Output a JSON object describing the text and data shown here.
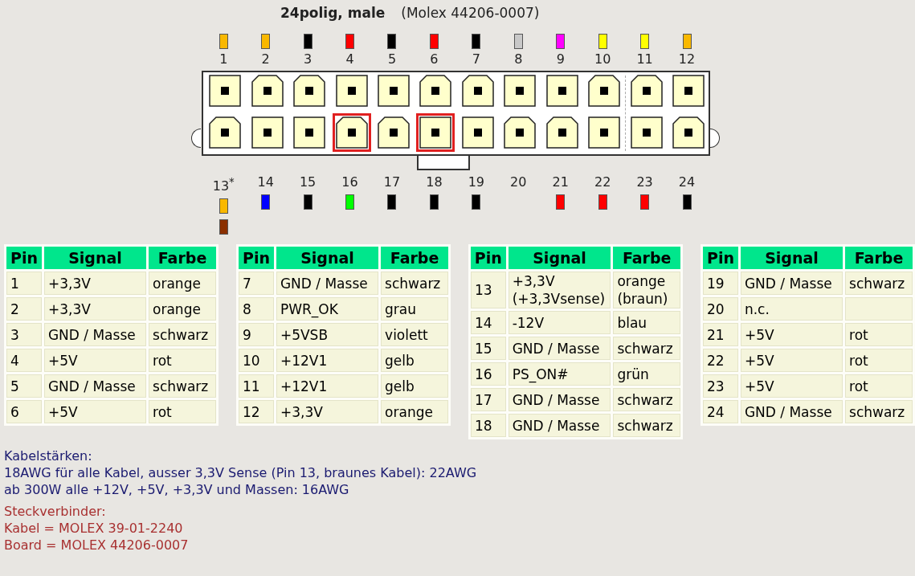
{
  "title": {
    "name": "24polig, male",
    "part": "(Molex 44206-0007)"
  },
  "connector": {
    "top_pins": [
      {
        "label": "1",
        "kind": "square",
        "highlighted": false,
        "wires": [
          {
            "color": "#f9b800"
          }
        ]
      },
      {
        "label": "2",
        "kind": "chamfered",
        "highlighted": false,
        "wires": [
          {
            "color": "#f9b800"
          }
        ]
      },
      {
        "label": "3",
        "kind": "chamfered",
        "highlighted": false,
        "wires": [
          {
            "color": "#000000"
          }
        ]
      },
      {
        "label": "4",
        "kind": "square",
        "highlighted": false,
        "wires": [
          {
            "color": "#ff0000"
          }
        ]
      },
      {
        "label": "5",
        "kind": "square",
        "highlighted": false,
        "wires": [
          {
            "color": "#000000"
          }
        ]
      },
      {
        "label": "6",
        "kind": "chamfered",
        "highlighted": false,
        "wires": [
          {
            "color": "#ff0000"
          }
        ]
      },
      {
        "label": "7",
        "kind": "chamfered",
        "highlighted": false,
        "wires": [
          {
            "color": "#000000"
          }
        ]
      },
      {
        "label": "8",
        "kind": "square",
        "highlighted": false,
        "wires": [
          {
            "color": "#c8c8c8"
          }
        ]
      },
      {
        "label": "9",
        "kind": "square",
        "highlighted": false,
        "wires": [
          {
            "color": "#ff00ff"
          }
        ]
      },
      {
        "label": "10",
        "kind": "chamfered",
        "highlighted": false,
        "wires": [
          {
            "color": "#ffff00"
          }
        ]
      },
      {
        "label": "11",
        "kind": "chamfered",
        "highlighted": false,
        "wires": [
          {
            "color": "#ffff00"
          }
        ]
      },
      {
        "label": "12",
        "kind": "square",
        "highlighted": false,
        "wires": [
          {
            "color": "#f9b800"
          }
        ]
      }
    ],
    "bottom_pins": [
      {
        "label": "13$^{*}$",
        "kind": "chamfered",
        "highlighted": false,
        "wires": [
          {
            "color": "#f9b800"
          },
          {
            "color": "#8b3000"
          }
        ]
      },
      {
        "label": "14",
        "kind": "square",
        "highlighted": false,
        "wires": [
          {
            "color": "#0000ff"
          }
        ]
      },
      {
        "label": "15",
        "kind": "square",
        "highlighted": false,
        "wires": [
          {
            "color": "#000000"
          }
        ]
      },
      {
        "label": "16",
        "kind": "chamfered",
        "highlighted": true,
        "wires": [
          {
            "color": "#00ff00"
          }
        ]
      },
      {
        "label": "17",
        "kind": "chamfered",
        "highlighted": false,
        "wires": [
          {
            "color": "#000000"
          }
        ]
      },
      {
        "label": "18",
        "kind": "square",
        "highlighted": true,
        "wires": [
          {
            "color": "#000000"
          }
        ]
      },
      {
        "label": "19",
        "kind": "square",
        "highlighted": false,
        "wires": [
          {
            "color": "#000000"
          }
        ]
      },
      {
        "label": "20",
        "kind": "chamfered",
        "highlighted": false
      },
      {
        "label": "21",
        "kind": "chamfered",
        "highlighted": false,
        "wires": [
          {
            "color": "#ff0000"
          }
        ]
      },
      {
        "label": "22",
        "kind": "square",
        "highlighted": false,
        "wires": [
          {
            "color": "#ff0000"
          }
        ]
      },
      {
        "label": "23",
        "kind": "square",
        "highlighted": false,
        "wires": [
          {
            "color": "#ff0000"
          }
        ]
      },
      {
        "label": "24",
        "kind": "chamfered",
        "highlighted": false,
        "wires": [
          {
            "color": "#000000"
          }
        ]
      }
    ]
  },
  "tables": [
    {
      "columns": [
        "Pin",
        "Signal",
        "Farbe"
      ],
      "rows": [
        {
          "pin": "1",
          "signal": "+3,3V",
          "wire": "orange"
        },
        {
          "pin": "2",
          "signal": "+3,3V",
          "wire": "orange"
        },
        {
          "pin": "3",
          "signal": "GND / Masse",
          "wire": "schwarz"
        },
        {
          "pin": "4",
          "signal": "+5V",
          "wire": "rot"
        },
        {
          "pin": "5",
          "signal": "GND / Masse",
          "wire": "schwarz"
        },
        {
          "pin": "6",
          "signal": "+5V",
          "wire": "rot"
        }
      ]
    },
    {
      "columns": [
        "Pin",
        "Signal",
        "Farbe"
      ],
      "rows": [
        {
          "pin": "7",
          "signal": "GND / Masse",
          "wire": "schwarz"
        },
        {
          "pin": "8",
          "signal": "PWR_OK",
          "wire": "grau"
        },
        {
          "pin": "9",
          "signal": "+5VSB",
          "wire": "violett"
        },
        {
          "pin": "10",
          "signal": "+12V1",
          "wire": "gelb"
        },
        {
          "pin": "11",
          "signal": "+12V1",
          "wire": "gelb"
        },
        {
          "pin": "12",
          "signal": "+3,3V",
          "wire": "orange"
        }
      ]
    },
    {
      "columns": [
        "Pin",
        "Signal",
        "Farbe"
      ],
      "rows": [
        {
          "pin": "13",
          "signal": "+3,3V (+3,3Vsense)",
          "wire": "orange (braun)"
        },
        {
          "pin": "14",
          "signal": "-12V",
          "wire": "blau"
        },
        {
          "pin": "15",
          "signal": "GND / Masse",
          "wire": "schwarz"
        },
        {
          "pin": "16",
          "signal": "PS_ON#",
          "wire": "grün"
        },
        {
          "pin": "17",
          "signal": "GND / Masse",
          "wire": "schwarz"
        },
        {
          "pin": "18",
          "signal": "GND / Masse",
          "wire": "schwarz"
        }
      ]
    },
    {
      "columns": [
        "Pin",
        "Signal",
        "Farbe"
      ],
      "rows": [
        {
          "pin": "19",
          "signal": "GND / Masse",
          "wire": "schwarz"
        },
        {
          "pin": "20",
          "signal": "n.c."
        },
        {
          "pin": "21",
          "signal": "+5V",
          "wire": "rot"
        },
        {
          "pin": "22",
          "signal": "+5V",
          "wire": "rot"
        },
        {
          "pin": "23",
          "signal": "+5V",
          "wire": "rot"
        },
        {
          "pin": "24",
          "signal": "GND / Masse",
          "wire": "schwarz"
        }
      ]
    }
  ],
  "notes": [
    {
      "kind": "gauges",
      "lines": [
        "Kabelstärken:",
        "18AWG für alle Kabel, ausser 3,3V Sense (Pin 13, braunes Kabel): 22AWG",
        "ab 300W alle +12V, +5V, +3,3V und Massen: 16AWG"
      ]
    },
    {
      "kind": "connectors",
      "lines": [
        "Steckverbinder:",
        "Kabel = MOLEX 39-01-2240",
        "Board = MOLEX 44206-0007"
      ]
    }
  ]
}
